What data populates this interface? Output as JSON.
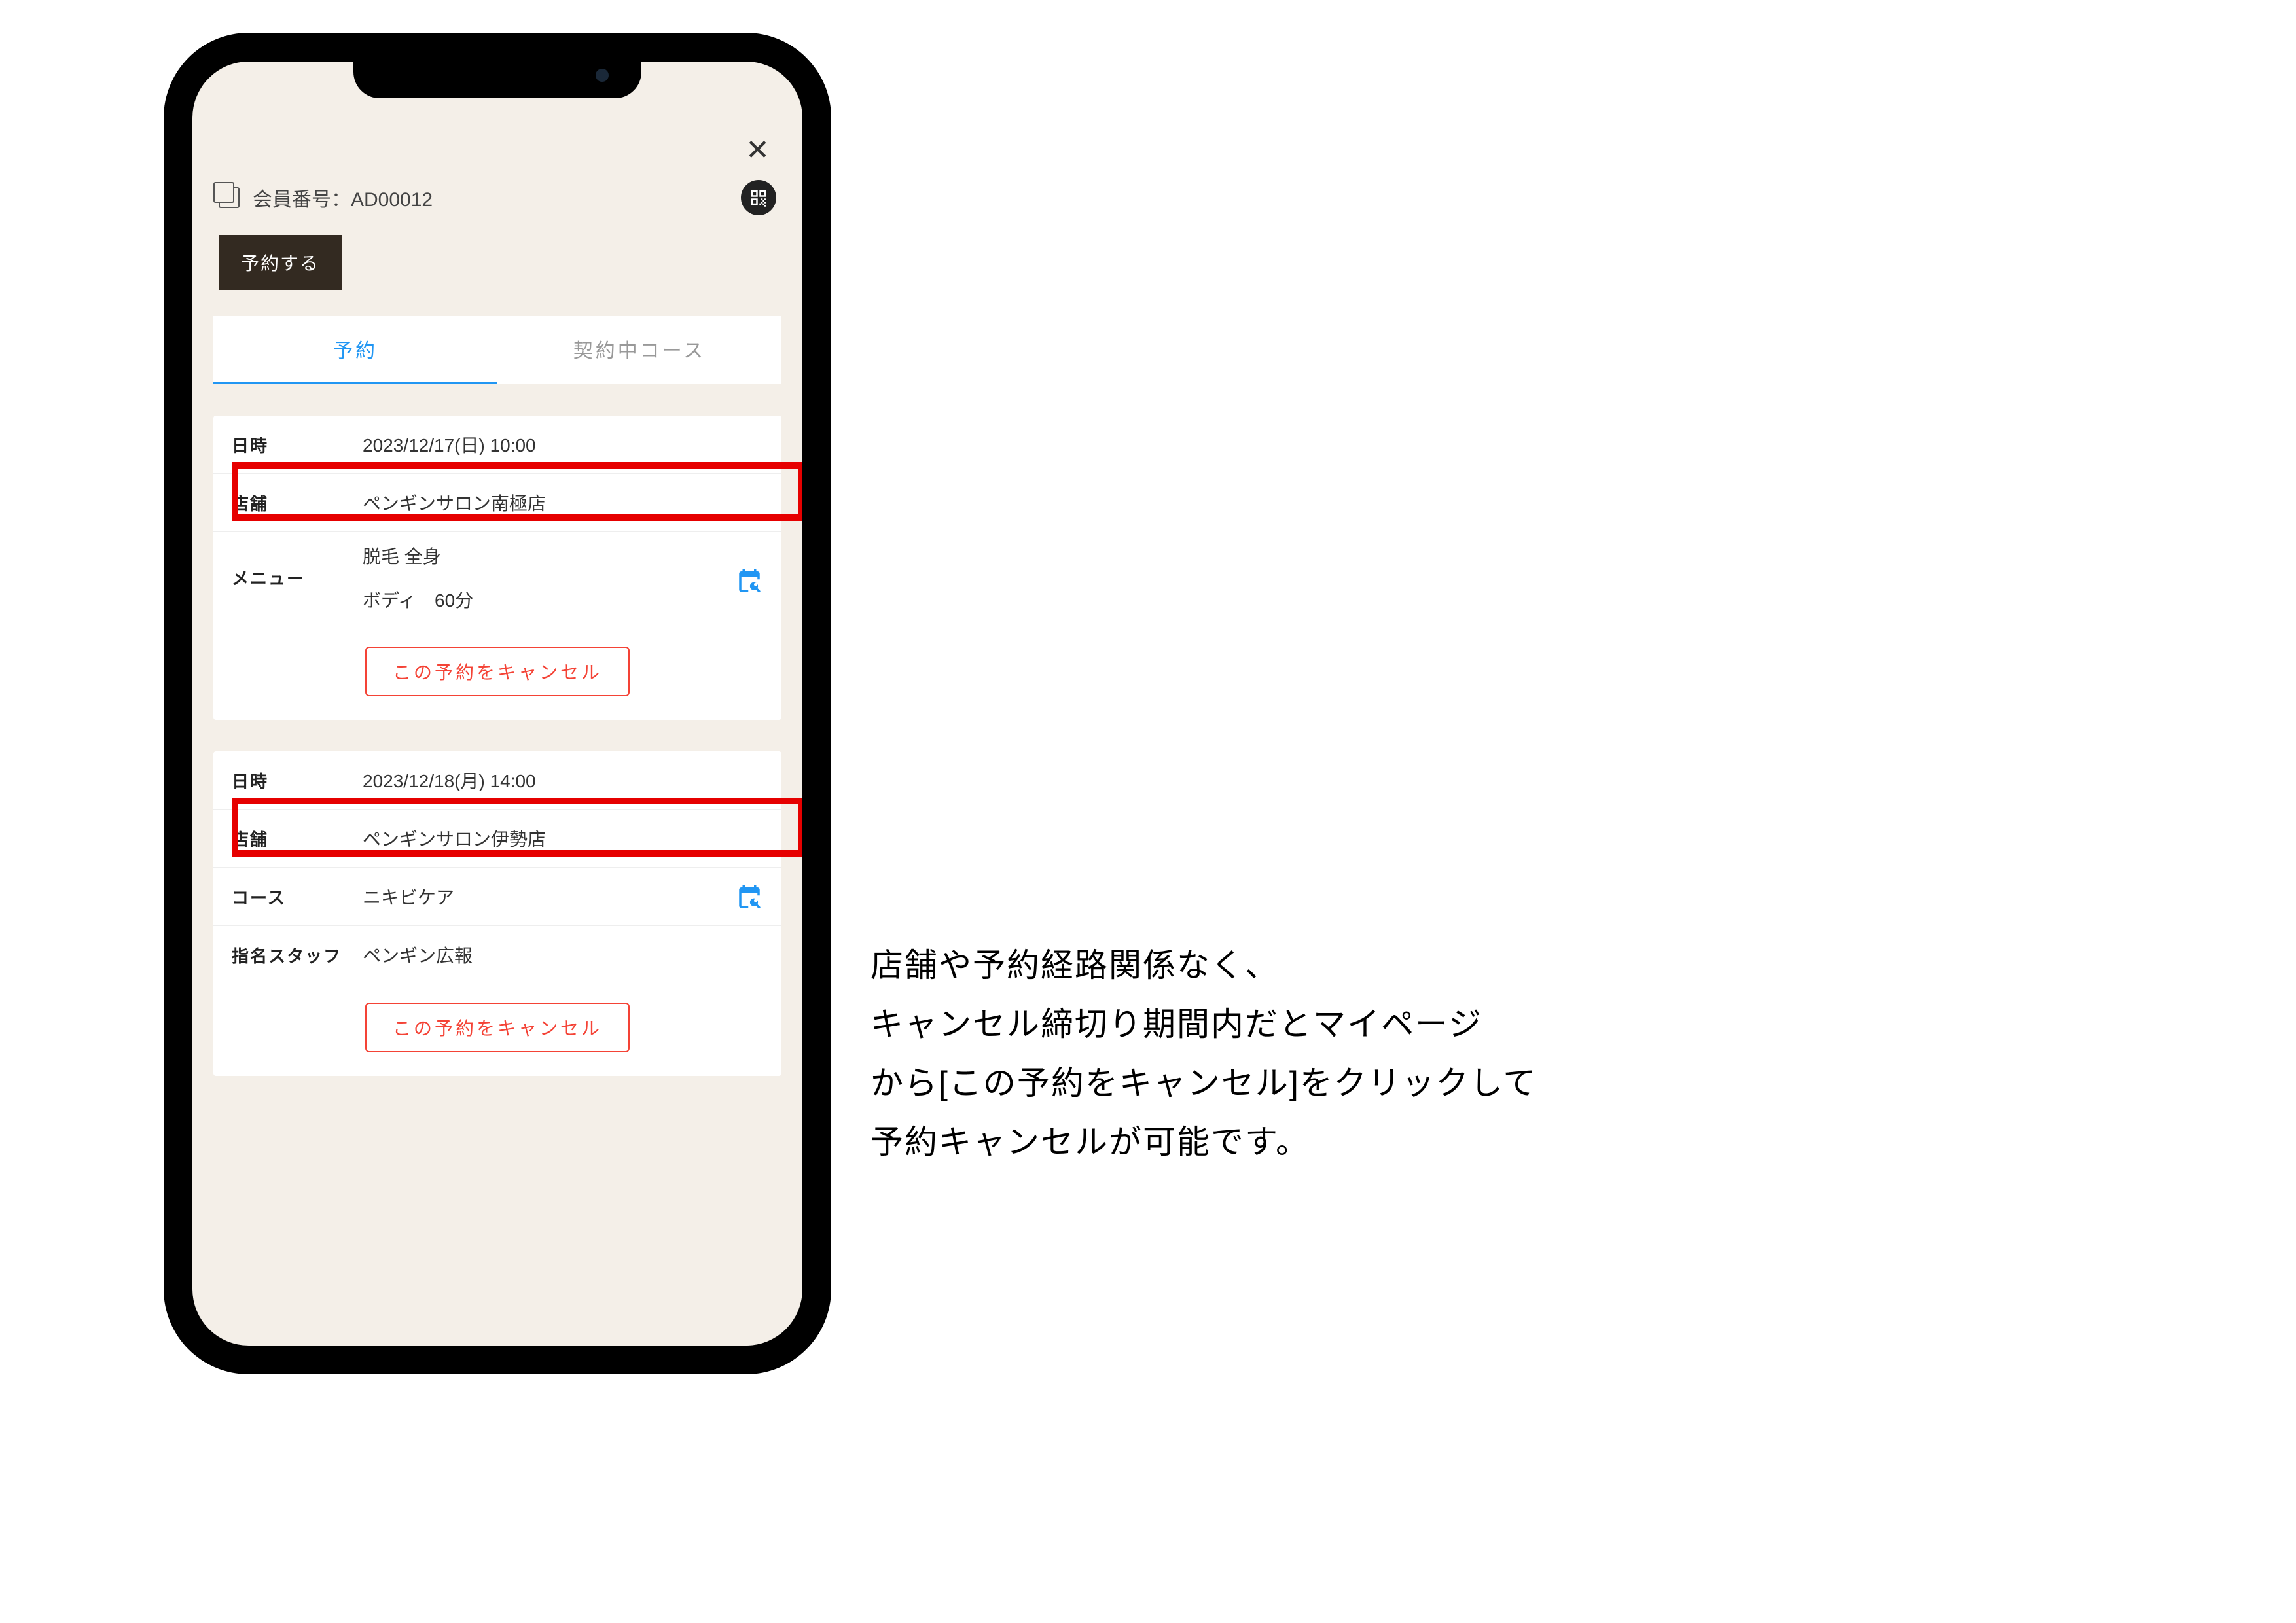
{
  "header": {
    "member_label": "会員番号：AD00012"
  },
  "buttons": {
    "reserve": "予約する",
    "cancel": "この予約をキャンセル"
  },
  "tabs": {
    "active": "予約",
    "inactive": "契約中コース"
  },
  "labels": {
    "datetime": "日時",
    "store": "店舗",
    "menu": "メニュー",
    "course": "コース",
    "staff": "指名スタッフ"
  },
  "reservations": [
    {
      "datetime": "2023/12/17(日) 10:00",
      "store": "ペンギンサロン南極店",
      "menu_lines": [
        "脱毛 全身",
        "ボディ　60分"
      ]
    },
    {
      "datetime": "2023/12/18(月) 14:00",
      "store": "ペンギンサロン伊勢店",
      "course": "ニキビケア",
      "staff": "ペンギン広報"
    }
  ],
  "explanation": {
    "line1": "店舗や予約経路関係なく、",
    "line2": "キャンセル締切り期間内だとマイページ",
    "line3": "から[この予約をキャンセル]をクリックして",
    "line4": "予約キャンセルが可能です。"
  },
  "icons": {
    "close": "✕"
  }
}
